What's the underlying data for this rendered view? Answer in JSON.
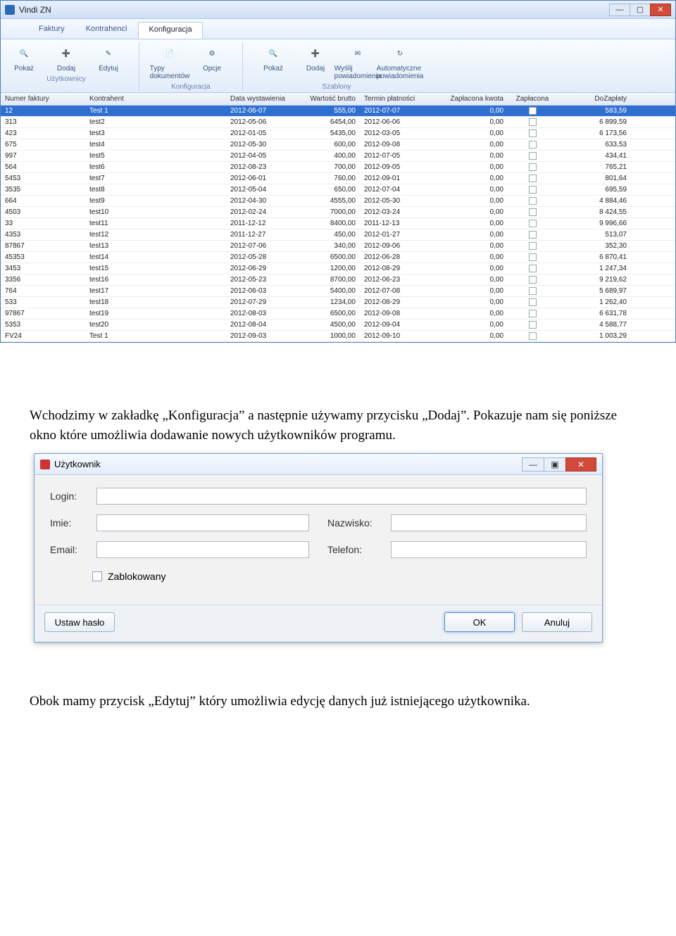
{
  "window": {
    "title": "Vindi ZN",
    "min": "—",
    "max": "▢",
    "close": "✕"
  },
  "tabs": [
    "Faktury",
    "Kontrahenci",
    "Konfiguracja"
  ],
  "tab_active": 2,
  "ribbon": {
    "groups": [
      {
        "label": "Użytkownicy",
        "buttons": [
          {
            "name": "pokaz",
            "label": "Pokaż",
            "icon": "🔍"
          },
          {
            "name": "dodaj",
            "label": "Dodaj",
            "icon": "➕"
          },
          {
            "name": "edytuj",
            "label": "Edytuj",
            "icon": "✎"
          }
        ]
      },
      {
        "label": "Konfiguracja",
        "buttons": [
          {
            "name": "typy",
            "label": "Typy dokumentów",
            "icon": "📄"
          },
          {
            "name": "opcje",
            "label": "Opcje",
            "icon": "⚙"
          }
        ]
      },
      {
        "label": "Szablony",
        "buttons": [
          {
            "name": "pokaz2",
            "label": "Pokaż",
            "icon": "🔍"
          },
          {
            "name": "dodaj2",
            "label": "Dodaj",
            "icon": "➕"
          },
          {
            "name": "wyslij",
            "label": "Wyślij powiadomienia",
            "icon": "✉"
          },
          {
            "name": "auto",
            "label": "Automatyczne powiadomienia",
            "icon": "↻"
          }
        ]
      }
    ]
  },
  "grid": {
    "headers": [
      "Numer faktury",
      "Kontrahent",
      "Data wystawienia",
      "Wartość brutto",
      "Termin płatności",
      "Zapłacona kwota",
      "Zapłacona",
      "DoZapłaty"
    ],
    "rows": [
      [
        "12",
        "Test 1",
        "2012-06-07",
        "555,00",
        "2012-07-07",
        "0,00",
        "",
        "583,59"
      ],
      [
        "313",
        "test2",
        "2012-05-06",
        "6454,00",
        "2012-06-06",
        "0,00",
        "",
        "6 899,59"
      ],
      [
        "423",
        "test3",
        "2012-01-05",
        "5435,00",
        "2012-03-05",
        "0,00",
        "",
        "6 173,56"
      ],
      [
        "675",
        "test4",
        "2012-05-30",
        "600,00",
        "2012-09-08",
        "0,00",
        "",
        "633,53"
      ],
      [
        "997",
        "test5",
        "2012-04-05",
        "400,00",
        "2012-07-05",
        "0,00",
        "",
        "434,41"
      ],
      [
        "564",
        "test6",
        "2012-08-23",
        "700,00",
        "2012-09-05",
        "0,00",
        "",
        "765,21"
      ],
      [
        "5453",
        "test7",
        "2012-06-01",
        "760,00",
        "2012-09-01",
        "0,00",
        "",
        "801,64"
      ],
      [
        "3535",
        "test8",
        "2012-05-04",
        "650,00",
        "2012-07-04",
        "0,00",
        "",
        "695,59"
      ],
      [
        "664",
        "test9",
        "2012-04-30",
        "4555,00",
        "2012-05-30",
        "0,00",
        "",
        "4 884,46"
      ],
      [
        "4503",
        "test10",
        "2012-02-24",
        "7000,00",
        "2012-03-24",
        "0,00",
        "",
        "8 424,55"
      ],
      [
        "33",
        "test11",
        "2011-12-12",
        "8400,00",
        "2011-12-13",
        "0,00",
        "",
        "9 996,66"
      ],
      [
        "4353",
        "test12",
        "2011-12-27",
        "450,00",
        "2012-01-27",
        "0,00",
        "",
        "513,07"
      ],
      [
        "87867",
        "test13",
        "2012-07-06",
        "340,00",
        "2012-09-06",
        "0,00",
        "",
        "352,30"
      ],
      [
        "45353",
        "test14",
        "2012-05-28",
        "6500,00",
        "2012-06-28",
        "0,00",
        "",
        "6 870,41"
      ],
      [
        "3453",
        "test15",
        "2012-06-29",
        "1200,00",
        "2012-08-29",
        "0,00",
        "",
        "1 247,34"
      ],
      [
        "3356",
        "test16",
        "2012-05-23",
        "8700,00",
        "2012-06-23",
        "0,00",
        "",
        "9 219,62"
      ],
      [
        "764",
        "test17",
        "2012-06-03",
        "5400,00",
        "2012-07-08",
        "0,00",
        "",
        "5 689,97"
      ],
      [
        "533",
        "test18",
        "2012-07-29",
        "1234,00",
        "2012-08-29",
        "0,00",
        "",
        "1 262,40"
      ],
      [
        "97867",
        "test19",
        "2012-08-03",
        "6500,00",
        "2012-09-08",
        "0,00",
        "",
        "6 631,78"
      ],
      [
        "5353",
        "test20",
        "2012-08-04",
        "4500,00",
        "2012-09-04",
        "0,00",
        "",
        "4 588,77"
      ],
      [
        "FV24",
        "Test 1",
        "2012-09-03",
        "1000,00",
        "2012-09-10",
        "0,00",
        "",
        "1 003,29"
      ]
    ]
  },
  "para1": "Wchodzimy w zakładkę „Konfiguracja” a następnie używamy przycisku „Dodaj”. Pokazuje nam się poniższe okno które umożliwia dodawanie nowych użytkowników programu.",
  "dialog": {
    "title": "Użytkownik",
    "login_lbl": "Login:",
    "imie_lbl": "Imie:",
    "email_lbl": "Email:",
    "nazwisko_lbl": "Nazwisko:",
    "telefon_lbl": "Telefon:",
    "zablokowany_lbl": "Zablokowany",
    "ustaw_haslo": "Ustaw hasło",
    "ok": "OK",
    "anuluj": "Anuluj",
    "min": "—",
    "max": "▣",
    "close": "✕"
  },
  "para2": "Obok mamy przycisk „Edytuj” który umożliwia edycję danych już istniejącego użytkownika."
}
